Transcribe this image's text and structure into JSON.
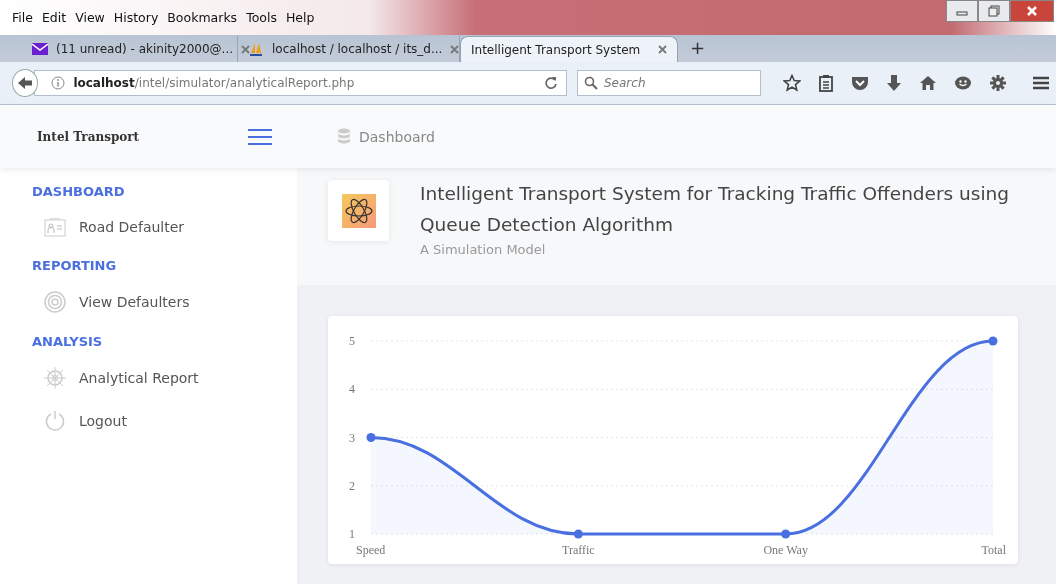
{
  "menu_bar": [
    "File",
    "Edit",
    "View",
    "History",
    "Bookmarks",
    "Tools",
    "Help"
  ],
  "tabs": [
    {
      "label": "(11 unread) - akinity2000@...",
      "kind": "mail",
      "selected": false
    },
    {
      "label": "localhost / localhost / its_d...",
      "kind": "pma",
      "selected": false
    },
    {
      "label": "Intelligent Transport System",
      "kind": "page",
      "selected": true
    }
  ],
  "new_tab": "+",
  "address_bar": {
    "url": "**localhost**/intel/simulator/analyticalReport.php"
  },
  "search": {
    "placeholder": "Search"
  },
  "header": {
    "brand": "Intel Transport",
    "breadcrumb": "Dashboard"
  },
  "sidebar": {
    "sections": [
      {
        "heading": "DASHBOARD",
        "items": [
          {
            "label": "Road Defaulter",
            "kind": "id-card"
          }
        ]
      },
      {
        "heading": "REPORTING",
        "items": [
          {
            "label": "View Defaulters",
            "kind": "target"
          }
        ]
      },
      {
        "heading": "ANALYSIS",
        "items": [
          {
            "label": "Analytical Report",
            "kind": "wheel"
          },
          {
            "label": "Logout",
            "kind": "power"
          }
        ]
      }
    ]
  },
  "banner": {
    "title": "Intelligent Transport System for Tracking Traffic Offenders using Queue Detection Algorithm",
    "subtitle": "A Simulation Model"
  },
  "chart_data": {
    "type": "area",
    "categories": [
      "Speed",
      "Traffic",
      "One Way",
      "Total"
    ],
    "series": [
      {
        "color": "#4a6fe0",
        "values": [
          3,
          1,
          1,
          5
        ]
      }
    ],
    "ylim": [
      1,
      5
    ],
    "yticks": [
      1,
      2,
      3,
      4,
      5
    ],
    "grid": true
  }
}
